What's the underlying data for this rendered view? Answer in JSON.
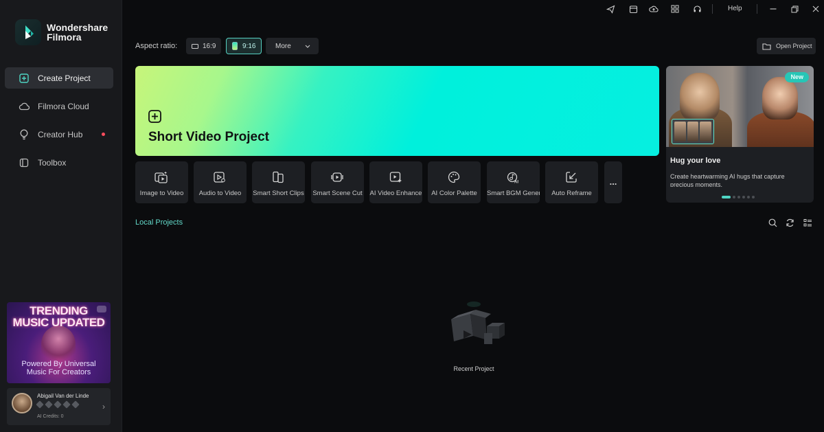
{
  "app": {
    "brand_line1": "Wondershare",
    "brand_line2": "Filmora"
  },
  "sidebar": {
    "items": [
      {
        "label": "Create Project",
        "icon": "plus-square-icon",
        "active": true
      },
      {
        "label": "Filmora Cloud",
        "icon": "cloud-icon"
      },
      {
        "label": "Creator Hub",
        "icon": "lightbulb-icon",
        "has_dot": true
      },
      {
        "label": "Toolbox",
        "icon": "toolbox-icon"
      }
    ],
    "promo": {
      "title_line1": "TRENDING",
      "title_line2": "MUSIC UPDATED",
      "subtitle_line1": "Powered By Universal",
      "subtitle_line2": "Music For Creators"
    },
    "user": {
      "name": "Abigail Van der Linde",
      "credits": "AI Credits: 0"
    }
  },
  "topbar": {
    "icons": [
      "send-icon",
      "calendar-icon",
      "cloud-upload-icon",
      "grid-icon",
      "headset-icon"
    ],
    "help_label": "Help",
    "window_controls": [
      "minimize-icon",
      "restore-icon",
      "close-icon"
    ]
  },
  "aspect": {
    "label": "Aspect ratio:",
    "options": [
      "16:9",
      "9:16"
    ],
    "selected": "9:16",
    "more_label": "More"
  },
  "open_project_label": "Open Project",
  "hero": {
    "title": "Short Video Project"
  },
  "tools": [
    {
      "label": "Image to Video",
      "icon": "image-to-video-icon"
    },
    {
      "label": "Audio to Video",
      "icon": "audio-to-video-icon"
    },
    {
      "label": "Smart Short Clips",
      "icon": "smart-short-clips-icon"
    },
    {
      "label": "Smart Scene Cut",
      "icon": "smart-scene-cut-icon"
    },
    {
      "label": "AI Video Enhance",
      "icon": "ai-video-enhance-icon"
    },
    {
      "label": "AI Color Palette",
      "icon": "ai-color-palette-icon"
    },
    {
      "label": "Smart BGM Gener.",
      "icon": "smart-bgm-icon"
    },
    {
      "label": "Auto Reframe",
      "icon": "auto-reframe-icon"
    }
  ],
  "more_tools_label": "...",
  "feature": {
    "badge": "New",
    "title": "Hug your love",
    "description": "Create heartwarming AI hugs that capture precious moments.",
    "slides": 6,
    "active_slide": 1
  },
  "local_projects": {
    "title": "Local Projects",
    "empty_label": "Recent Project"
  },
  "colors": {
    "accent": "#4fd6c4",
    "background": "#0b0c0e",
    "sidebar": "#18191c"
  }
}
